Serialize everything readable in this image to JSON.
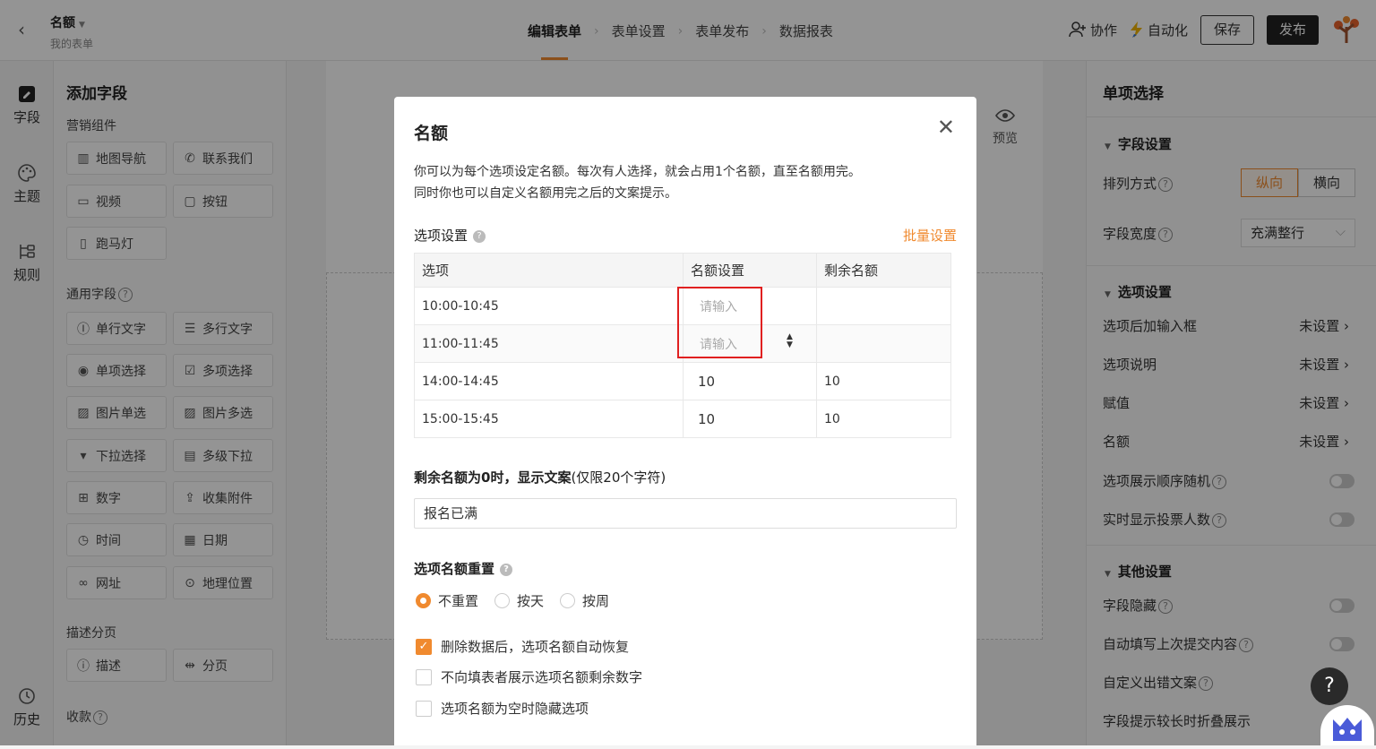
{
  "header": {
    "form_name": "名额",
    "form_sub": "我的表单",
    "steps": [
      "编辑表单",
      "表单设置",
      "表单发布",
      "数据报表"
    ],
    "collab": "协作",
    "automation": "自动化",
    "save": "保存",
    "publish": "发布"
  },
  "leftnav": [
    "字段",
    "主题",
    "规则",
    "历史"
  ],
  "fields": {
    "title": "添加字段",
    "marketing": "营销组件",
    "marketing_items": [
      "地图导航",
      "联系我们",
      "视频",
      "按钮",
      "跑马灯"
    ],
    "common": "通用字段",
    "common_items": [
      "单行文字",
      "多行文字",
      "单项选择",
      "多项选择",
      "图片单选",
      "图片多选",
      "下拉选择",
      "多级下拉",
      "数字",
      "收集附件",
      "时间",
      "日期",
      "网址",
      "地理位置"
    ],
    "desc": "描述分页",
    "desc_items": [
      "描述",
      "分页"
    ],
    "collect": "收款"
  },
  "preview": "预览",
  "right": {
    "title": "单项选择",
    "field_settings": "字段设置",
    "arrange": "排列方式",
    "arrange_v": "纵向",
    "arrange_h": "横向",
    "width": "字段宽度",
    "width_val": "充满整行",
    "option_settings": "选项设置",
    "opt_rows": [
      {
        "label": "选项后加输入框",
        "value": "未设置 ›"
      },
      {
        "label": "选项说明",
        "value": "未设置 ›"
      },
      {
        "label": "赋值",
        "value": "未设置 ›"
      },
      {
        "label": "名额",
        "value": "未设置 ›"
      }
    ],
    "random": "选项展示顺序随机",
    "votes": "实时显示投票人数",
    "other": "其他设置",
    "hide": "字段隐藏",
    "autofill": "自动填写上次提交内容",
    "err": "自定义出错文案",
    "fold": "字段提示较长时折叠展示"
  },
  "modal": {
    "title": "名额",
    "desc1": "你可以为每个选项设定名额。每次有人选择，就会占用1个名额，直至名额用完。",
    "desc2": "同时你也可以自定义名额用完之后的文案提示。",
    "opt_settings": "选项设置",
    "batch": "批量设置",
    "cols": [
      "选项",
      "名额设置",
      "剩余名额"
    ],
    "rows": [
      {
        "opt": "10:00-10:45",
        "quota": "",
        "left": ""
      },
      {
        "opt": "11:00-11:45",
        "quota": "",
        "left": ""
      },
      {
        "opt": "14:00-14:45",
        "quota": "10",
        "left": "10"
      },
      {
        "opt": "15:00-15:45",
        "quota": "10",
        "left": "10"
      }
    ],
    "placeholder": "请输入",
    "zero_label_bold": "剩余名额为0时，显示文案",
    "zero_label_note": "(仅限20个字符)",
    "zero_text": "报名已满",
    "reset_label": "选项名额重置",
    "reset_opts": [
      "不重置",
      "按天",
      "按周"
    ],
    "checks": [
      "删除数据后，选项名额自动恢复",
      "不向填表者展示选项名额剩余数字",
      "选项名额为空时隐藏选项"
    ]
  },
  "help": "?"
}
